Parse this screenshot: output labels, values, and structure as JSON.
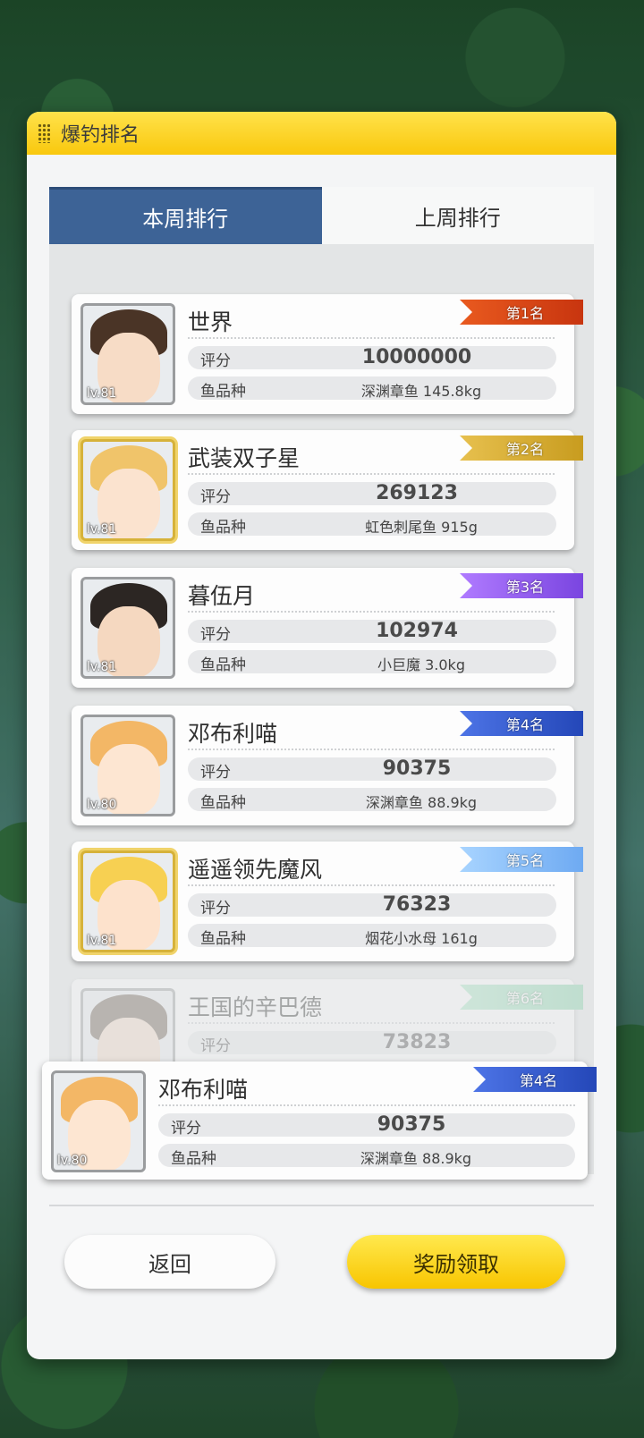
{
  "dialog": {
    "title": "爆钓排名"
  },
  "tabs": [
    {
      "label": "本周排行",
      "active": true
    },
    {
      "label": "上周排行",
      "active": false
    }
  ],
  "labels": {
    "score": "评分",
    "fish": "鱼品种"
  },
  "ranking": [
    {
      "name": "世界",
      "score": "10000000",
      "fish": "深渊章鱼 145.8kg",
      "level": "lv.81",
      "rank": "第1名"
    },
    {
      "name": "武装双子星",
      "score": "269123",
      "fish": "虹色刺尾鱼 915g",
      "level": "lv.81",
      "rank": "第2名"
    },
    {
      "name": "暮伍月",
      "score": "102974",
      "fish": "小巨魔 3.0kg",
      "level": "lv.81",
      "rank": "第3名"
    },
    {
      "name": "邓布利喵",
      "score": "90375",
      "fish": "深渊章鱼 88.9kg",
      "level": "lv.80",
      "rank": "第4名"
    },
    {
      "name": "遥遥领先魔风",
      "score": "76323",
      "fish": "烟花小水母 161g",
      "level": "lv.81",
      "rank": "第5名"
    },
    {
      "name": "王国的辛巴德",
      "score": "73823",
      "fish": "",
      "level": "",
      "rank": "第6名"
    }
  ],
  "me": {
    "name": "邓布利喵",
    "score": "90375",
    "fish": "深渊章鱼 88.9kg",
    "level": "lv.80",
    "rank": "第4名"
  },
  "buttons": {
    "back": "返回",
    "claim": "奖励领取"
  },
  "colors": {
    "title_bar": "#f9c80e",
    "tab_active": "#3d6396",
    "claim_button": "#f8c500"
  }
}
